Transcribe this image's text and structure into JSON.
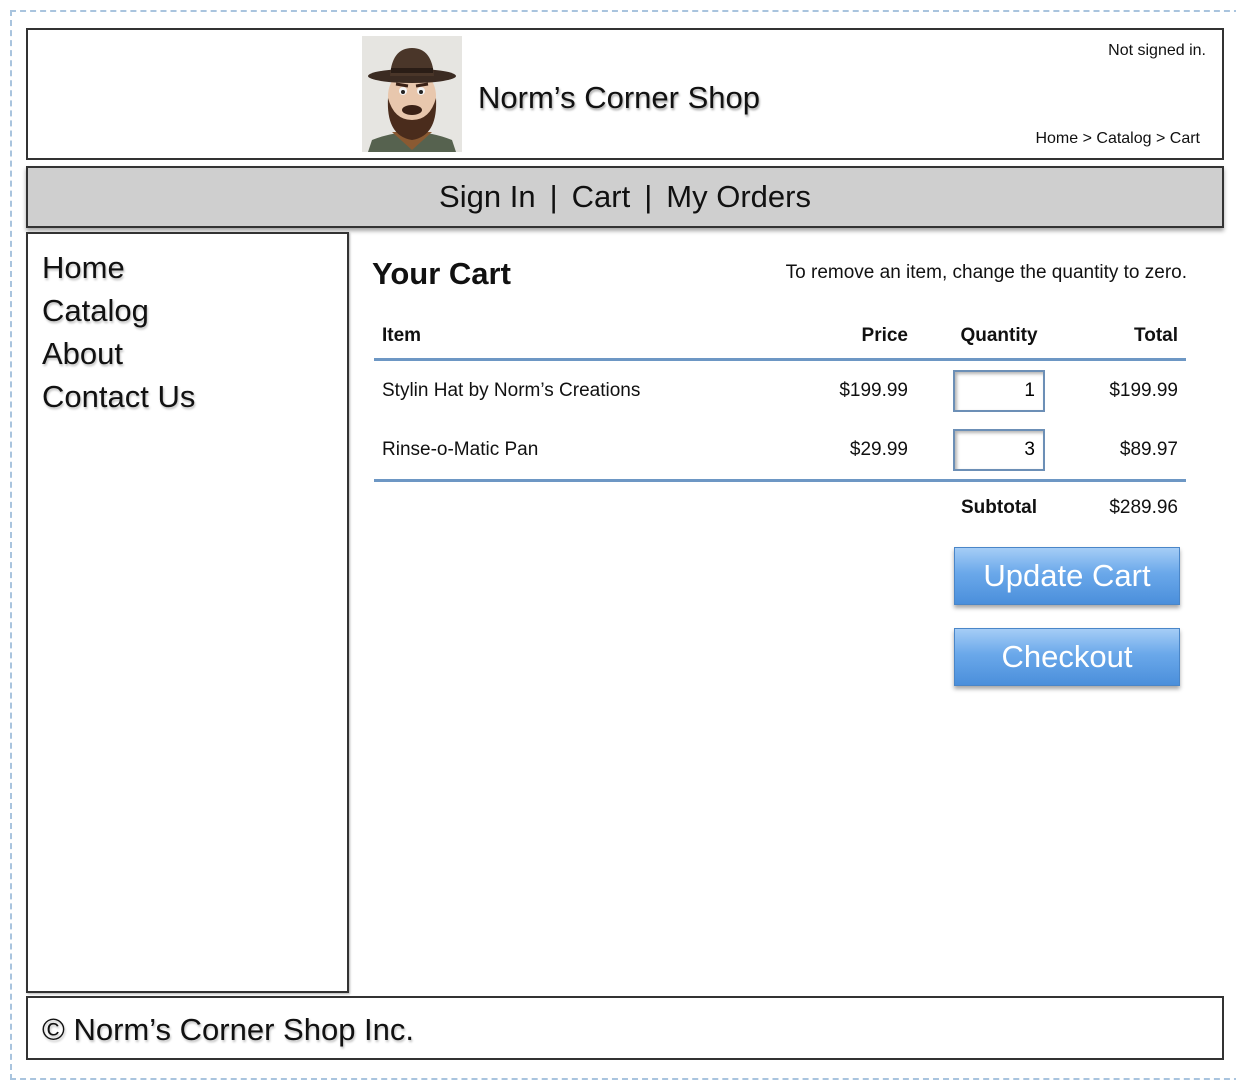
{
  "header": {
    "shop_name": "Norm’s Corner Shop",
    "signed_status": "Not signed in.",
    "breadcrumb": "Home > Catalog > Cart"
  },
  "nav": {
    "sign_in": "Sign In",
    "cart": "Cart",
    "my_orders": "My Orders",
    "separator": "|"
  },
  "sidebar": {
    "items": [
      {
        "label": "Home"
      },
      {
        "label": "Catalog"
      },
      {
        "label": "About"
      },
      {
        "label": "Contact Us"
      }
    ]
  },
  "main": {
    "title": "Your Cart",
    "hint": "To remove an item, change the quantity to zero.",
    "columns": {
      "item": "Item",
      "price": "Price",
      "quantity": "Quantity",
      "total": "Total"
    },
    "rows": [
      {
        "item": "Stylin Hat by Norm’s Creations",
        "price": "$199.99",
        "quantity": "1",
        "total": "$199.99"
      },
      {
        "item": "Rinse-o-Matic Pan",
        "price": "$29.99",
        "quantity": "3",
        "total": "$89.97"
      }
    ],
    "subtotal_label": "Subtotal",
    "subtotal_value": "$289.96",
    "update_button": "Update Cart",
    "checkout_button": "Checkout"
  },
  "footer": {
    "copyright": "© Norm’s Corner Shop Inc."
  },
  "colors": {
    "accent_rule": "#6d97c4",
    "button_blue": "#6aa8ea",
    "nav_bg": "#cfcfcf"
  }
}
